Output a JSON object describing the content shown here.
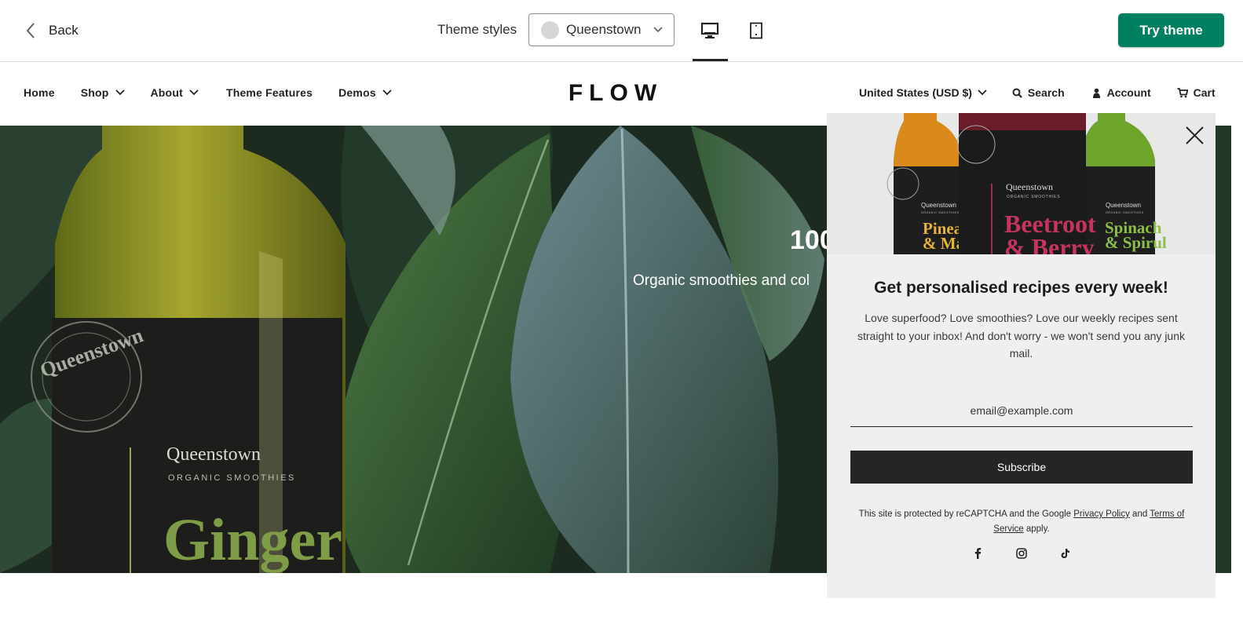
{
  "editor": {
    "back_label": "Back",
    "theme_styles_label": "Theme styles",
    "theme_select_value": "Queenstown",
    "try_theme_label": "Try theme"
  },
  "store": {
    "logo": "FLOW",
    "nav": [
      {
        "label": "Home",
        "dropdown": false
      },
      {
        "label": "Shop",
        "dropdown": true
      },
      {
        "label": "About",
        "dropdown": true
      },
      {
        "label": "Theme Features",
        "dropdown": false
      },
      {
        "label": "Demos",
        "dropdown": true
      }
    ],
    "currency": "United States (USD $)",
    "search_label": "Search",
    "account_label": "Account",
    "cart_label": "Cart"
  },
  "hero": {
    "title_fragment": "100",
    "subtitle_fragment": "Organic smoothies and col",
    "bottle_brand": "Queenstown",
    "bottle_line": "ORGANIC SMOOTHIES",
    "bottle_flavor": "Ginger",
    "seal_text": "Queenstown"
  },
  "popup": {
    "bottles": [
      {
        "brand": "Queenstown",
        "line": "ORGANIC SMOOTHIES",
        "flavor1": "Pinea",
        "flavor2": "& Ma",
        "color": "#e4b53a"
      },
      {
        "brand": "Queenstown",
        "line": "ORGANIC SMOOTHIES",
        "flavor1": "Beetroot",
        "flavor2": "& Berry",
        "color": "#c4345f"
      },
      {
        "brand": "Queenstown",
        "line": "ORGANIC SMOOTHIES",
        "flavor1": "Spinach",
        "flavor2": "& Spirul",
        "color": "#8cbf4a"
      }
    ],
    "title": "Get personalised recipes every week!",
    "description": "Love superfood? Love smoothies? Love our weekly recipes sent straight to your inbox! And don't worry - we won't send you any junk mail.",
    "email_placeholder": "email@example.com",
    "subscribe_label": "Subscribe",
    "legal_prefix": "This site is protected by reCAPTCHA and the Google",
    "privacy_link": "Privacy Policy",
    "legal_and": "and",
    "terms_link": "Terms of Service",
    "legal_suffix": "apply.",
    "socials": [
      "facebook-icon",
      "instagram-icon",
      "tiktok-icon"
    ]
  },
  "colors": {
    "accent": "#008060",
    "button_dark": "#252525",
    "popup_bg": "#efefef"
  }
}
